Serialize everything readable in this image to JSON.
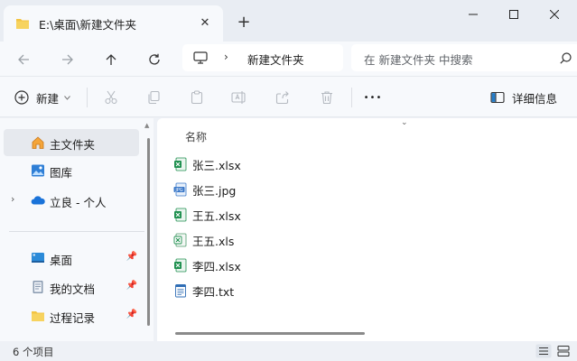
{
  "window": {
    "tab_title": "E:\\桌面\\新建文件夹",
    "close_tab_glyph": "✕",
    "new_tab_glyph": "+"
  },
  "address": {
    "crumb": "新建文件夹",
    "search_placeholder": "在 新建文件夹 中搜索"
  },
  "toolbar": {
    "new_label": "新建",
    "details_label": "详细信息",
    "more_glyph": "•••"
  },
  "sidebar": {
    "items": [
      {
        "label": "主文件夹",
        "icon": "home-icon"
      },
      {
        "label": "图库",
        "icon": "gallery-icon"
      },
      {
        "label": "立良 - 个人",
        "icon": "onedrive-icon"
      },
      {
        "label": "桌面",
        "icon": "desktop-icon"
      },
      {
        "label": "我的文档",
        "icon": "documents-icon"
      },
      {
        "label": "过程记录",
        "icon": "folder-icon"
      }
    ]
  },
  "main": {
    "column_name": "名称",
    "files": [
      {
        "name": "张三.xlsx",
        "type": "excel"
      },
      {
        "name": "张三.jpg",
        "type": "jpg"
      },
      {
        "name": "王五.xlsx",
        "type": "excel"
      },
      {
        "name": "王五.xls",
        "type": "excel-legacy"
      },
      {
        "name": "李四.xlsx",
        "type": "excel"
      },
      {
        "name": "李四.txt",
        "type": "text"
      }
    ]
  },
  "status": {
    "count": "6 个项目"
  },
  "colors": {
    "accent": "#0067c0",
    "excel_green": "#1d8f4e",
    "folder_yellow": "#f3c443",
    "window_bg": "#eef1f6"
  }
}
